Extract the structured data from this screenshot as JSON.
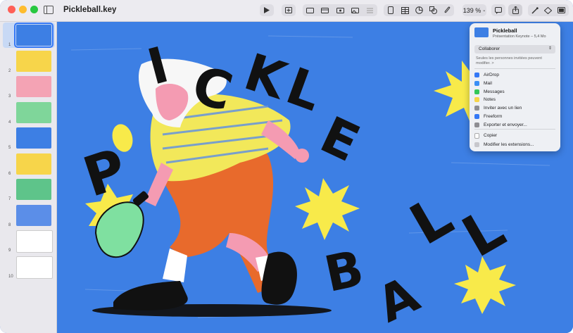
{
  "window": {
    "title": "Pickleball.key"
  },
  "toolbar": {
    "zoom": "139 %",
    "colors": {
      "red": "#ff5f57",
      "yellow": "#febc2e",
      "green": "#28c840"
    }
  },
  "sidebar": {
    "slides": [
      {
        "number": "1",
        "bg": "#3d7fe4"
      },
      {
        "number": "2",
        "bg": "#f7d54a"
      },
      {
        "number": "3",
        "bg": "#f4a3b4"
      },
      {
        "number": "4",
        "bg": "#7fd69a"
      },
      {
        "number": "5",
        "bg": "#3d7fe4"
      },
      {
        "number": "6",
        "bg": "#f7d54a"
      },
      {
        "number": "7",
        "bg": "#5ec48a"
      },
      {
        "number": "8",
        "bg": "#5b8ee8"
      },
      {
        "number": "9",
        "bg": "#ffffff"
      },
      {
        "number": "10",
        "bg": "#ffffff"
      }
    ]
  },
  "canvas": {
    "word_top": "PICKLE",
    "word_bottom": "BALL",
    "colors": {
      "bg": "#3d7fe4",
      "star": "#f8ea4a",
      "shirt": "#f2e85a",
      "pants": "#e86a2c",
      "skin": "#f49bb2",
      "paddle": "#7fe0a0"
    }
  },
  "share": {
    "doc_name": "Pickleball",
    "doc_info": "Présentation Keynote – 5,4 Mo",
    "collab_label": "Collaborer",
    "access_note": "Seules les personnes invitées peuvent modifier. >",
    "items": [
      {
        "label": "AirDrop",
        "icon": "airdrop-icon",
        "color": "#3478f6"
      },
      {
        "label": "Mail",
        "icon": "mail-icon",
        "color": "#3a8ef6"
      },
      {
        "label": "Messages",
        "icon": "messages-icon",
        "color": "#34c759"
      },
      {
        "label": "Notes",
        "icon": "notes-icon",
        "color": "#f7d54a"
      },
      {
        "label": "Inviter avec un lien",
        "icon": "link-icon",
        "color": "#8e8e93"
      },
      {
        "label": "Freeform",
        "icon": "freeform-icon",
        "color": "#3478f6"
      },
      {
        "label": "Exporter et envoyer...",
        "icon": "export-icon",
        "color": "#8e8e93"
      }
    ],
    "copy_label": "Copier",
    "extensions_label": "Modifier les extensions..."
  }
}
